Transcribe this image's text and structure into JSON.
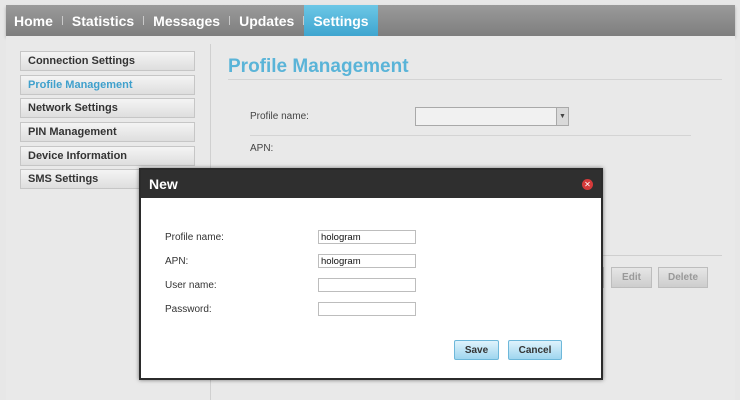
{
  "nav": {
    "items": [
      "Home",
      "Statistics",
      "Messages",
      "Updates",
      "Settings"
    ],
    "active": "Settings"
  },
  "sidebar": {
    "items": [
      {
        "label": "Connection Settings"
      },
      {
        "label": "Profile Management"
      },
      {
        "label": "Network Settings"
      },
      {
        "label": "PIN Management"
      },
      {
        "label": "Device Information"
      },
      {
        "label": "SMS Settings"
      }
    ],
    "active": "Profile Management"
  },
  "main": {
    "title": "Profile Management",
    "profile_name_label": "Profile name:",
    "profile_name_value": "",
    "apn_label": "APN:",
    "buttons": {
      "edit": "Edit",
      "delete": "Delete"
    }
  },
  "dialog": {
    "title": "New",
    "fields": [
      {
        "label": "Profile name:",
        "value": "hologram"
      },
      {
        "label": "APN:",
        "value": "hologram"
      },
      {
        "label": "User name:",
        "value": ""
      },
      {
        "label": "Password:",
        "value": ""
      }
    ],
    "save_label": "Save",
    "cancel_label": "Cancel",
    "close_icon": "close-icon"
  },
  "colors": {
    "accent": "#5ab4d8",
    "nav_bar": "#8a8a8a",
    "dialog_header": "#2f2f2f",
    "close_button": "#d53a3a"
  }
}
